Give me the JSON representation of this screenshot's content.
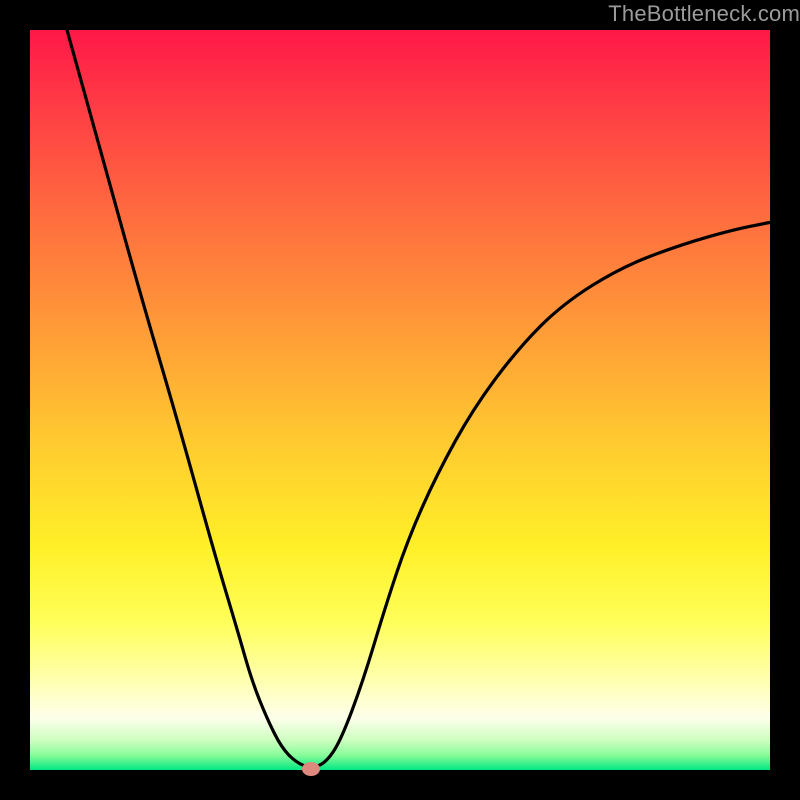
{
  "watermark": "TheBottleneck.com",
  "chart_data": {
    "type": "line",
    "title": "",
    "xlabel": "",
    "ylabel": "",
    "xlim": [
      0,
      100
    ],
    "ylim": [
      0,
      100
    ],
    "grid": false,
    "series": [
      {
        "name": "bottleneck-curve",
        "x": [
          5,
          10,
          15,
          20,
          25,
          28,
          30,
          32,
          34,
          36,
          38,
          40,
          42,
          45,
          48,
          51,
          55,
          60,
          66,
          72,
          80,
          88,
          95,
          100
        ],
        "y": [
          100,
          82,
          64,
          47,
          29,
          19,
          12,
          7,
          3,
          1,
          0.2,
          1,
          4,
          12,
          22,
          31,
          40,
          49,
          57,
          63,
          68,
          71,
          73,
          74
        ]
      }
    ],
    "min_point": {
      "x": 38,
      "y": 0.2
    },
    "background_gradient": {
      "direction": "vertical",
      "stops": [
        {
          "pos": 0,
          "color": "#ff1848"
        },
        {
          "pos": 50,
          "color": "#ffd030"
        },
        {
          "pos": 80,
          "color": "#ffff60"
        },
        {
          "pos": 100,
          "color": "#00e882"
        }
      ]
    },
    "curve_color": "#000000",
    "marker_color": "#dd897d"
  }
}
